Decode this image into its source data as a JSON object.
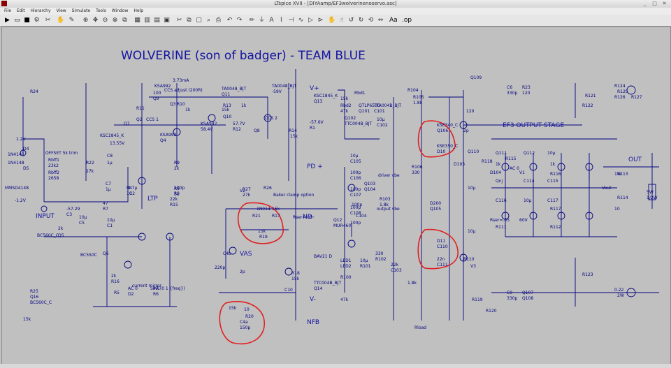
{
  "window": {
    "title": "LTspice XVII - [DIYAamp/EF3wolverinenoservo.asc]",
    "minimize": "_",
    "maximize": "□",
    "close": "✕"
  },
  "menu": [
    "File",
    "Edit",
    "Hierarchy",
    "View",
    "Simulate",
    "Tools",
    "Window",
    "Help"
  ],
  "schematic": {
    "title": "WOLVERINE (son of badger) - TEAM BLUE",
    "sections": {
      "output_stage": "EF3 OUTPUT STAGE",
      "nfb": "NFB",
      "vas": "VAS",
      "ltp": "LTP",
      "input": "INPUT",
      "current_mirror": "current mirror",
      "offset_trim": "OFFSET 5k trim",
      "vplus": "V+",
      "vminus": "V-",
      "pd_plus": "PD +",
      "nd_minus": "ND-",
      "out": "OUT",
      "vout": "Vout",
      "baker": "Baker clamp option",
      "driver": "driver vbe",
      "output_vbe": "output vbe",
      "ccs1": "CCS 1",
      "ccs2": "CCS 2",
      "ccs_adjust": "CCS adjust (200R)"
    },
    "labels": [
      "R24",
      "R25",
      "1.2V",
      "D4",
      "D5",
      "1N4148",
      "1N4148",
      "MMSD4148",
      "-1.2V",
      "Rbff1",
      "Rbff2",
      "23k2",
      "2658",
      "R22",
      "27k",
      "C7",
      "1µ",
      "R9",
      "2k",
      "C8",
      "1µ",
      "R8",
      "5k",
      "R4",
      "10",
      "Q7",
      "KSC1845_K",
      "13.55V",
      "Q2",
      "Q3",
      "KSA992",
      "Q4",
      "KSA992",
      "R10",
      "1k",
      "3.73mA",
      "R11",
      "100",
      "Q9",
      "KSA992",
      "58.4V",
      "57.7V",
      "R12",
      "1k",
      "R13",
      "15k",
      "R14",
      "15k",
      "Q10",
      "Q8",
      "TA0048_BJT",
      "Q11",
      "TA0048_BJT",
      "-59V",
      "-57.29",
      "C3",
      "10µ",
      "C5",
      "10µ",
      "C1",
      "4.7µ",
      "C2",
      "100p",
      "R3",
      "15k",
      "R5",
      "47",
      "R6",
      "47",
      "R7",
      "22k",
      "R15",
      "2k",
      "R16",
      "2k",
      "Q5",
      "BC560C_C",
      "Q6",
      "BC550C",
      "Q16",
      "BC560C_C",
      "V2",
      "SINE(0 1 {freq})",
      "AC 0",
      "D2",
      "1N914",
      "R21",
      "15k",
      "R17",
      "15k",
      "R19",
      "10",
      "R20",
      "15k",
      "C4a",
      "150p",
      "C4b",
      "220p",
      "R18",
      "15k",
      "C10",
      "2p",
      "R26",
      "R27",
      "27k",
      "Q12",
      "KSC1845_K",
      "Q13",
      "TTC004B_BJT",
      "Q14",
      "-57.6V",
      "BAV21 D",
      "R1",
      "15k",
      "R100",
      "Rbd1",
      "47k",
      "Rbd2",
      "47k",
      "LED1",
      "LED2",
      "QTLP650C",
      "Q101",
      "Q102",
      "TTC004B_BJT",
      "TTA004B_BJT",
      "C101",
      "10µ",
      "C102",
      "10µ",
      "R101",
      "330",
      "R102",
      "22k",
      "C103",
      "100p",
      "C104",
      "10µ",
      "C105",
      "100p",
      "C106",
      "100p",
      "C107",
      "100p",
      "C108",
      "100p",
      "Q103",
      "Q104",
      "R103",
      "1.8k",
      "R104",
      "1.8k",
      "R105",
      "1.8k",
      "R106",
      "330",
      "D200",
      "Q105",
      "KSE340_C",
      "Q106",
      "KSE350_C",
      "D10",
      "D11",
      "C110",
      "22n",
      "C111",
      "2p",
      "R110",
      "1k",
      "R111",
      "1k",
      "R112",
      "120",
      "C6",
      "330p",
      "R23",
      "120",
      "C9",
      "330p",
      "Q107",
      "Q108",
      "Q109",
      "Q110",
      "Q111",
      "Q112",
      "Qnj",
      "C114",
      "10µ",
      "C115",
      "10µ",
      "C116",
      "10µ",
      "C117",
      "10µ",
      "R113",
      "R114",
      "R115",
      "R116",
      "R117",
      "R118",
      "R119",
      "R120",
      "R121",
      "R122",
      "R123",
      "R124",
      "R125",
      "R126",
      "R127",
      "0.22",
      "2W",
      "5W",
      "1/2W",
      "1W",
      "10",
      "D103",
      "MUR460",
      "D104",
      "V1",
      "Rser=.05",
      "60V",
      "AC 0",
      "V3",
      "Rser=.05",
      "Rload",
      "8",
      "C118",
      "C119",
      ".68µ",
      "S00R",
      "Q113",
      "Q114",
      "Q115",
      "Q116",
      "Qnjw0281G",
      "Qnjw0302G",
      "-2V",
      "freq"
    ],
    "annotations": [
      "C6 / R23 phase lead (circled)",
      "C9 / R112 phase lead (circled)",
      "C4a / C4b / R18 (circled)",
      "C10 / R27 (circled)"
    ]
  },
  "colors": {
    "wire": "#000080",
    "text": "#1414a0",
    "annot": "#e02020",
    "bg": "#c0c0c0"
  }
}
